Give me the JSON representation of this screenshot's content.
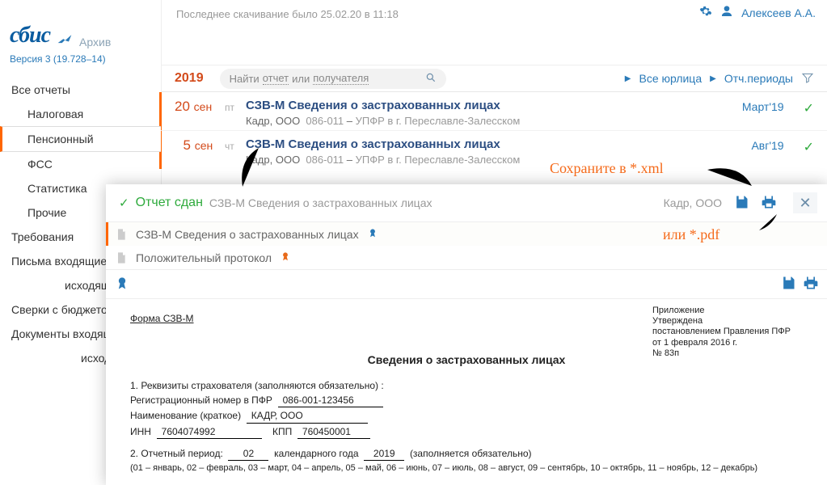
{
  "header": {
    "lastDownload": "Последнее скачивание было 25.02.20 в 11:18",
    "userName": "Алексеев А.А."
  },
  "brand": {
    "name": "сбис",
    "mode": "Архив",
    "version": "Версия 3 (19.728–14)"
  },
  "nav": {
    "allReports": "Все отчеты",
    "tax": "Налоговая",
    "pension": "Пенсионный",
    "fss": "ФСС",
    "stat": "Статистика",
    "other": "Прочие",
    "demands": "Требования",
    "lettersIn": "Письма входящие",
    "lettersOut": "исходящие",
    "reconcile": "Сверки с бюджетом",
    "docsIn": "Документы входящие",
    "docsOut": "исходящие"
  },
  "listHeader": {
    "year": "2019",
    "searchPrefix": "Найти",
    "searchMid": "отчет",
    "searchOr": "или",
    "searchSuffix": "получателя",
    "allOrgs": "Все юрлица",
    "periods": "Отч.периоды"
  },
  "rows": [
    {
      "day": "20",
      "month": "сен",
      "dow": "пт",
      "title": "СЗВ-М Сведения о застрахованных лицах",
      "org": "Кадр, ООО",
      "code": "086-011",
      "recipient": "УПФР в г. Переславле-Залесском",
      "period": "Март'19"
    },
    {
      "day": "5",
      "month": "сен",
      "dow": "чт",
      "title": "СЗВ-М Сведения о застрахованных лицах",
      "org": "Кадр, ООО",
      "code": "086-011",
      "recipient": "УПФР в г. Переславле-Залесском",
      "period": "Авг'19"
    }
  ],
  "panel": {
    "status": "Отчет сдан",
    "subtitle": "СЗВ-М Сведения о застрахованных лицах",
    "org": "Кадр, ООО",
    "tab1": "СЗВ-М Сведения о застрахованных лицах",
    "tab2": "Положительный протокол"
  },
  "doc": {
    "approval1": "Приложение",
    "approval2": "Утверждена",
    "approval3": "постановлением Правления ПФР",
    "approval4": "от 1 февраля 2016 г.",
    "approval5": "№ 83п",
    "formName": "Форма СЗВ-М",
    "heading": "Сведения о застрахованных лицах",
    "line1": "1. Реквизиты страхователя (заполняются обязательно) :",
    "regLabel": "Регистрационный номер в ПФР",
    "regVal": "086-001-123456",
    "nameLabel": "Наименование (краткое)",
    "nameVal": "КАДР, ООО",
    "innLabel": "ИНН",
    "innVal": "7604074992",
    "kppLabel": "КПП",
    "kppVal": "760450001",
    "line2a": "2. Отчетный период:",
    "monthVal": "02",
    "line2b": "календарного года",
    "yearVal": "2019",
    "line2c": "(заполняется обязательно)",
    "legend": "(01 – январь, 02 – февраль, 03 – март, 04 – апрель, 05 – май, 06 – июнь, 07 – июль, 08 – август, 09 – сентябрь, 10 – октябрь, 11 – ноябрь, 12 – декабрь)"
  },
  "annotations": {
    "saveXml": "Сохраните в *.xml",
    "orPdf": "или *.pdf"
  }
}
